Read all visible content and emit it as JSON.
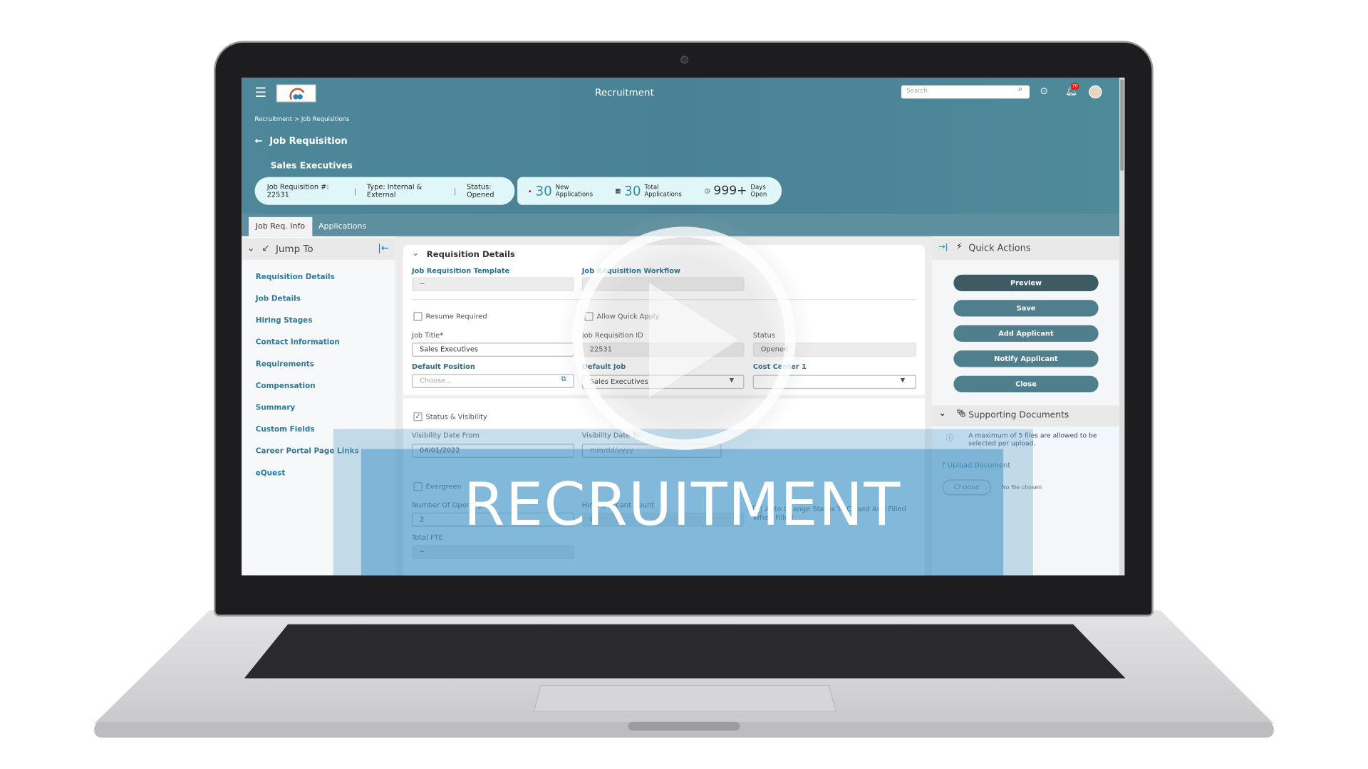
{
  "header": {
    "title": "Recruitment",
    "search_placeholder": "Search",
    "notification_count": "70"
  },
  "breadcrumb": "Recruitment > Job Requisitions",
  "page_title": "Job Requisition",
  "job_name": "Sales Executives",
  "summary": {
    "req_number": "Job Requisition #: 22531",
    "type": "Type: Internal & External",
    "status": "Status: Opened"
  },
  "stats": {
    "new_count": "30",
    "new_label": "New Applications",
    "total_count": "30",
    "total_label": "Total Applications",
    "days_count": "999+",
    "days_label": "Days Open"
  },
  "tabs": [
    {
      "label": "Job Req. Info",
      "active": true
    },
    {
      "label": "Applications",
      "active": false
    }
  ],
  "jump_to": {
    "title": "Jump To",
    "items": [
      "Requisition Details",
      "Job Details",
      "Hiring Stages",
      "Contact Information",
      "Requirements",
      "Compensation",
      "Summary",
      "Custom Fields",
      "Career Portal Page Links",
      "eQuest"
    ]
  },
  "form": {
    "section": "Requisition Details",
    "template_label": "Job Requisition Template",
    "template_value": "--",
    "workflow_label": "Job Requisition Workflow",
    "workflow_value": "--",
    "resume_required": "Resume Required",
    "allow_quick_apply": "Allow Quick Apply",
    "job_title_label": "Job Title",
    "job_title_value": "Sales Executives",
    "required_mark": "*",
    "req_id_label": "Job Requisition ID",
    "req_id_value": "22531",
    "status_label": "Status",
    "status_value": "Opened",
    "default_position_label": "Default Position",
    "default_position_placeholder": "Choose...",
    "default_job_label": "Default Job",
    "default_job_value": "Sales Executives",
    "cost_center_label": "Cost Center 1",
    "cost_center_value": "",
    "status_visibility": "Status & Visibility",
    "vis_from_label": "Visibility Date From",
    "vis_from_value": "04/01/2022",
    "vis_to_label": "Visibility Date To",
    "vis_to_placeholder": "mm/dd/yyyy",
    "evergreen": "Evergreen",
    "openings_label": "Number Of Openings",
    "openings_value": "2",
    "hire_count_label": "Hire Applicant Count",
    "hire_count_value": "0",
    "auto_change": "Auto Change Status To Closed And Filled When Filled",
    "fte_label": "Total FTE",
    "fte_value": "--"
  },
  "quick_actions": {
    "title": "Quick Actions",
    "buttons": [
      "Preview",
      "Save",
      "Add Applicant",
      "Notify Applicant",
      "Close"
    ]
  },
  "documents": {
    "title": "Supporting Documents",
    "info": "A maximum of 5 files are allowed to be selected per upload.",
    "upload_label": "Upload Document",
    "choose_label": "Choose",
    "no_file": "No file chosen"
  },
  "overlay": {
    "title": "RECRUITMENT",
    "icon": "play-icon"
  },
  "colors": {
    "header": "#4d8799",
    "accent": "#2b7a99",
    "button": "#4f7f8c",
    "banner": "#2c89c0"
  }
}
